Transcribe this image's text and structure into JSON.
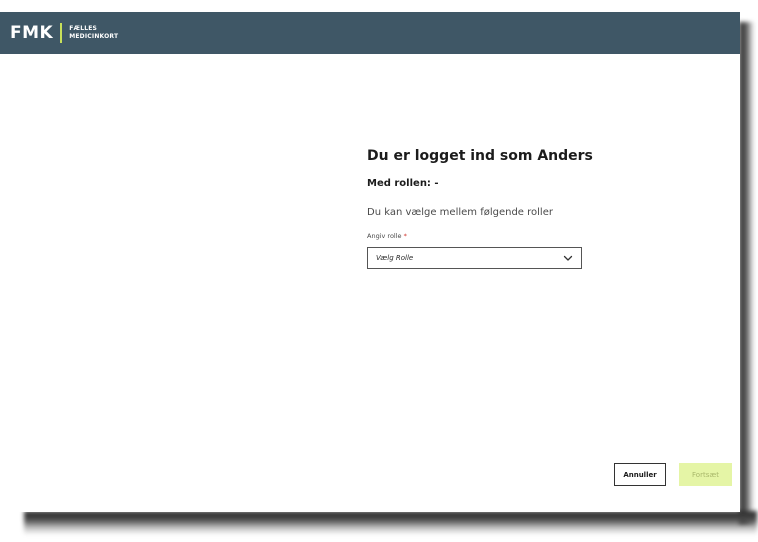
{
  "header": {
    "logo_text": "FMK",
    "logo_sub_line1": "FÆLLES",
    "logo_sub_line2": "MEDICINKORT",
    "accent_color": "#c8e05a",
    "background_color": "#3f5766"
  },
  "main": {
    "heading": "Du er logget ind som Anders",
    "role_line": "Med rollen: -",
    "choose_text": "Du kan vælge mellem følgende roller",
    "role_field": {
      "label": "Angiv rolle",
      "required_marker": "*",
      "selected_value": "Vælg Rolle",
      "icon": "chevron-down-icon"
    }
  },
  "footer": {
    "cancel_label": "Annuller",
    "continue_label": "Fortsæt",
    "continue_color": "#e5f5a6"
  }
}
